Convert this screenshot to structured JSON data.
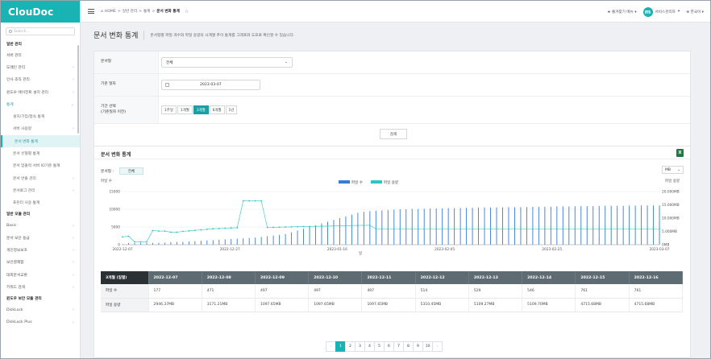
{
  "app": {
    "logo": "ClouDoc"
  },
  "sidebar": {
    "search_placeholder": "Search...",
    "items": [
      {
        "label": "일반 관리",
        "kind": "section"
      },
      {
        "label": "서버 관리",
        "kind": "item"
      },
      {
        "label": "도메인 관리",
        "kind": "item",
        "chevron": true
      },
      {
        "label": "인사 조직 관리",
        "kind": "item",
        "chevron": true
      },
      {
        "label": "윈도우 에이전트 설치 관리",
        "kind": "item",
        "chevron": true
      },
      {
        "label": "통계",
        "kind": "parent-open",
        "chevron": true
      },
      {
        "label": "설치/기입/접속 통계",
        "kind": "sub"
      },
      {
        "label": "서버 사용량",
        "kind": "sub",
        "chevron": true
      },
      {
        "label": "문서 변화 통계",
        "kind": "active"
      },
      {
        "label": "문서 유형별 통계",
        "kind": "sub"
      },
      {
        "label": "문서 입출력 서버 IO기준 통계",
        "kind": "sub"
      },
      {
        "label": "문서 반출 관리",
        "kind": "sub",
        "chevron": true
      },
      {
        "label": "문서로그 관리",
        "kind": "sub",
        "chevron": true
      },
      {
        "label": "프린터 사용 통계",
        "kind": "sub"
      },
      {
        "label": "일반 모듈 관리",
        "kind": "section"
      },
      {
        "label": "Basic",
        "kind": "item",
        "chevron": true
      },
      {
        "label": "문서 보안 등급",
        "kind": "item",
        "chevron": true
      },
      {
        "label": "개인정보보호",
        "kind": "item",
        "chevron": true
      },
      {
        "label": "보안결재함",
        "kind": "item",
        "chevron": true
      },
      {
        "label": "대외문서교환",
        "kind": "item",
        "chevron": true
      },
      {
        "label": "키워드 검색",
        "kind": "item",
        "chevron": true
      },
      {
        "label": "윈도우 보안 모듈 관리",
        "kind": "section"
      },
      {
        "label": "DiskLock",
        "kind": "item",
        "chevron": true
      },
      {
        "label": "DiskLock Plus",
        "kind": "item",
        "chevron": true
      }
    ]
  },
  "header": {
    "breadcrumb": [
      "HOME",
      "일반 관리",
      "통계",
      "문서 변화 통계"
    ],
    "favorites_label": "즐겨찾기 메뉴",
    "user_label": "서비스관리자",
    "avatar_letter": "m",
    "language_label": "한국어"
  },
  "page": {
    "title": "문서 변화 통계",
    "description": "문서형별 파일 개수와 파일 용량의 시계열 추이 통계를 그래프와 도표로 확인할 수 있습니다."
  },
  "filter": {
    "doc_type_label": "문서형",
    "doc_type_value": "전체",
    "base_date_label": "기준 일자",
    "base_date_value": "2023-03-07",
    "period_label_line1": "기간 선택",
    "period_label_line2": "(기준일자 이전)",
    "periods": [
      "1주일",
      "1개월",
      "3개월",
      "6개월",
      "1년"
    ],
    "period_selected": "3개월",
    "search_button": "검색"
  },
  "stats": {
    "title": "문서 변화 통계",
    "doc_type_label": "문서형 :",
    "doc_type_chip": "전체",
    "unit_select": "MB"
  },
  "chart_data": {
    "type": "bar",
    "legend": [
      "파일 수",
      "파일 용량"
    ],
    "y_left_label": "파일 수",
    "y_right_label": "파일 용량",
    "y_left_ticks": [
      "15000",
      "10000",
      "5000",
      "0"
    ],
    "y_right_ticks": [
      "20.000MB",
      "15.000MB",
      "10.000MB",
      "5.000MB",
      "0MB"
    ],
    "x_ticks": [
      "2022-12-07",
      "2022-12-27",
      "2023-01-16",
      "2023-02-05",
      "2023-02-25",
      "2023-03-07"
    ],
    "x_label": "일",
    "ylim_left": [
      0,
      15000
    ],
    "ylim_right": [
      0,
      20000
    ],
    "series": [
      {
        "name": "파일 수",
        "color": "#3a7bd5",
        "values": [
          177,
          471,
          497,
          497,
          497,
          514,
          529,
          546,
          761,
          761,
          800,
          900,
          1000,
          1100,
          1200,
          1300,
          1400,
          1500,
          1600,
          1700,
          1800,
          1900,
          2000,
          2200,
          2400,
          2600,
          2800,
          3000,
          3500,
          4000,
          4500,
          5000,
          5500,
          6000,
          6500,
          7000,
          7500,
          8000,
          8500,
          9000,
          9300,
          9500,
          9600,
          9700,
          9800,
          9900,
          10000,
          10000,
          10100,
          10100,
          10150,
          10200,
          10200,
          10250,
          10300,
          10300,
          10350,
          10400,
          10400,
          10450,
          10500,
          10500,
          10500,
          10550,
          10600,
          10600,
          10600,
          10650,
          10700,
          10700,
          10700,
          10750,
          10800,
          10800,
          10800,
          10850,
          10900,
          10900,
          10900,
          10950,
          11000,
          11000,
          11000,
          11000,
          11050,
          11050,
          11100,
          11100,
          11100,
          11100
        ]
      },
      {
        "name": "파일 용량",
        "color": "#2ec4c4",
        "values": [
          2946.37,
          3171.21,
          1097.65,
          1097.65,
          1097.65,
          5310.45,
          5109.27,
          5109.7,
          4715.68,
          4715.68,
          5000,
          5200,
          5400,
          5600,
          5800,
          6000,
          6100,
          6200,
          6300,
          6400,
          16500,
          16500,
          16500,
          16500,
          6500,
          6550,
          6600,
          6650,
          6700,
          6750,
          6800,
          6850,
          6900,
          6950,
          7000,
          7050,
          7100,
          7150,
          7200,
          7250,
          7300,
          7300,
          5900,
          5900,
          5900,
          5900,
          5900,
          5900,
          5900,
          5900,
          5900,
          5900,
          5900,
          5900,
          5900,
          5900,
          5900,
          5900,
          5900,
          5900,
          5900,
          5900,
          5900,
          5900,
          5900,
          5900,
          5900,
          5900,
          5900,
          5900,
          5900,
          5900,
          5900,
          5900,
          5900,
          5900,
          5900,
          5900,
          5900,
          5900,
          5900,
          5900,
          5900,
          5900,
          5900,
          5900,
          5900,
          5900,
          5900,
          5900
        ]
      }
    ]
  },
  "table": {
    "corner": "3개월 (일별)",
    "dates": [
      "2022-12-07",
      "2022-12-08",
      "2022-12-09",
      "2022-12-10",
      "2022-12-11",
      "2022-12-12",
      "2022-12-13",
      "2022-12-14",
      "2022-12-15",
      "2022-12-16"
    ],
    "rows": [
      {
        "label": "파일 수",
        "cells": [
          "177",
          "471",
          "497",
          "497",
          "497",
          "514",
          "529",
          "546",
          "761",
          "761"
        ]
      },
      {
        "label": "파일 용량",
        "cells": [
          "2946.37MB",
          "3171.21MB",
          "1097.65MB",
          "1097.65MB",
          "1097.65MB",
          "5310.45MB",
          "5109.27MB",
          "5109.70MB",
          "4715.68MB",
          "4715.68MB"
        ]
      }
    ]
  },
  "pager": {
    "prev": "‹",
    "next": "›",
    "pages": [
      "1",
      "2",
      "3",
      "4",
      "5",
      "6",
      "7",
      "8",
      "9",
      "10"
    ],
    "current": "1"
  }
}
